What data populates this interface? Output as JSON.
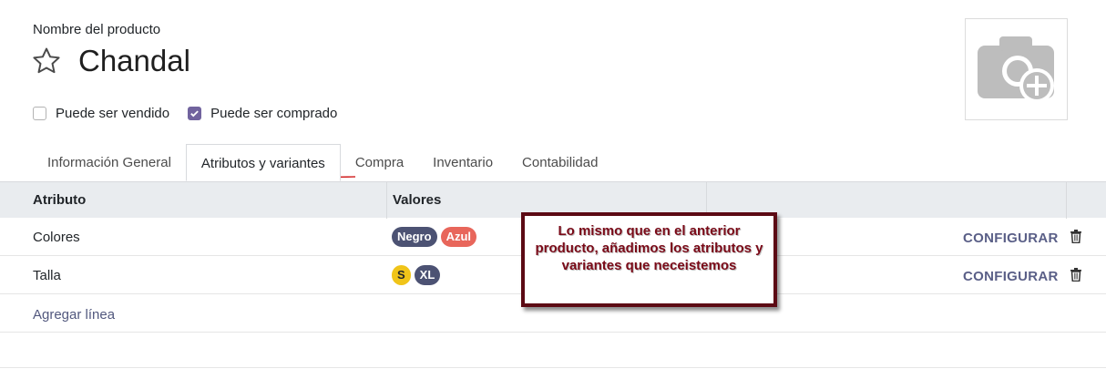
{
  "product": {
    "name_label": "Nombre del producto",
    "name": "Chandal"
  },
  "checkboxes": [
    {
      "label": "Puede ser vendido",
      "checked": false
    },
    {
      "label": "Puede ser comprado",
      "checked": true
    }
  ],
  "tabs": [
    {
      "label": "Información General"
    },
    {
      "label": "Atributos y variantes",
      "active": true
    },
    {
      "label": "Compra"
    },
    {
      "label": "Inventario"
    },
    {
      "label": "Contabilidad"
    }
  ],
  "table": {
    "headers": [
      "Atributo",
      "Valores"
    ],
    "rows": [
      {
        "attribute": "Colores",
        "values": [
          {
            "label": "Negro",
            "color": "#4c5273"
          },
          {
            "label": "Azul",
            "color": "#e8665b"
          }
        ],
        "action": "CONFIGURAR"
      },
      {
        "attribute": "Talla",
        "values": [
          {
            "label": "S",
            "color": "#f0c419",
            "text_color": "#212529"
          },
          {
            "label": "XL",
            "color": "#4c5273"
          }
        ],
        "action": "CONFIGURAR"
      }
    ],
    "add_line": "Agregar línea"
  },
  "annotation": {
    "text": "Lo mismo que en el anterior producto, añadimos los atributos y variantes que neceistemos"
  },
  "colors": {
    "accent": "#71639e",
    "link": "#5a5f87",
    "annotation_border": "#5c0a14",
    "annotation_text": "#7a0a18"
  }
}
